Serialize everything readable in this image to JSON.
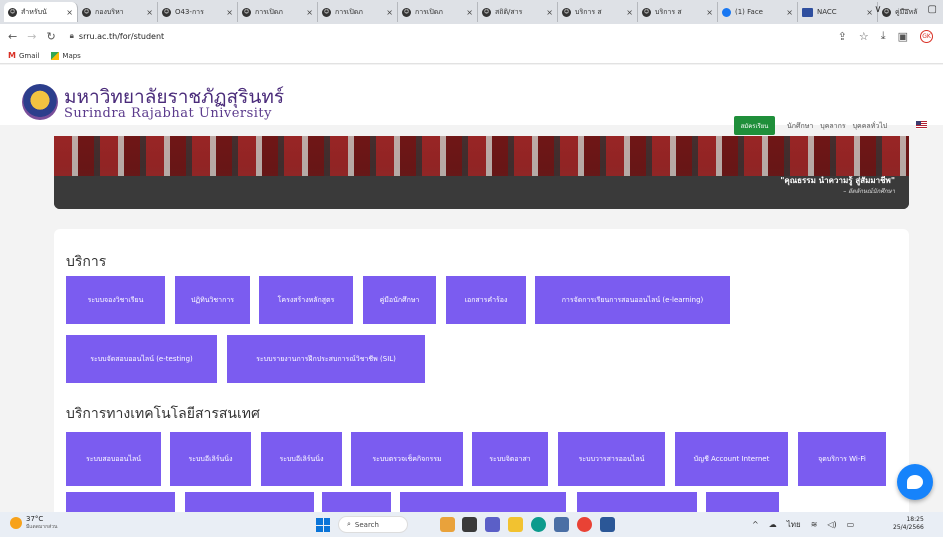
{
  "browser": {
    "tabs": [
      {
        "label": "สำหรับนั",
        "icon": "smile-favicon-icon",
        "active": true
      },
      {
        "label": "กองบริหา",
        "icon": "smile-favicon-icon"
      },
      {
        "label": "O43-การ",
        "icon": "smile-favicon-icon"
      },
      {
        "label": "การเปิดภ",
        "icon": "smile-favicon-icon"
      },
      {
        "label": "การเปิดภ",
        "icon": "smile-favicon-icon"
      },
      {
        "label": "การเปิดภ",
        "icon": "smile-favicon-icon"
      },
      {
        "label": "สถิติ/สาร",
        "icon": "smile-favicon-icon"
      },
      {
        "label": "บริการ ส",
        "icon": "smile-favicon-icon"
      },
      {
        "label": "บริการ ส",
        "icon": "smile-favicon-icon"
      },
      {
        "label": "(1) Face",
        "icon": "facebook-icon"
      },
      {
        "label": "NACC",
        "icon": "nacc-icon"
      },
      {
        "label": "คู่มือหลั",
        "icon": "smile-favicon-icon"
      }
    ],
    "tab_close": "×",
    "new_tab": "+",
    "window_controls": [
      "∨",
      "—",
      "▢"
    ],
    "url": "srru.ac.th/for/student",
    "bookmarks": [
      "Gmail",
      "Maps"
    ],
    "profile_initials": "GK"
  },
  "site": {
    "name_th": "มหาวิทยาลัยราชภัฏสุรินทร์",
    "name_en": "Surindra Rajabhat University",
    "apply_button": "สมัครเรียน",
    "nav": [
      "นักศึกษา",
      "บุคลากร",
      "บุคคลทั่วไป"
    ],
    "banner_quote": "\"คุณธรรม นำความรู้ สู่สัมมาชีพ\"",
    "banner_sub": "– อัตลักษณ์นักศึกษา"
  },
  "services": {
    "title": "บริการ",
    "row1": [
      "ระบบจองวิชาเรียน",
      "ปฏิทินวิชาการ",
      "โครงสร้างหลักสูตร",
      "คู่มือนักศึกษา",
      "เอกสารคำร้อง",
      "การจัดการเรียนการสอนออนไลน์ (e-learning)"
    ],
    "row2": [
      "ระบบจัดสอบออนไลน์ (e-testing)",
      "ระบบรายงานการฝึกประสบการณ์วิชาชีพ (SIL)"
    ]
  },
  "it_services": {
    "title": "บริการทางเทคโนโลยีสารสนเทศ",
    "row1": [
      "ระบบสอบออนไลน์",
      "ระบบอีเลิร์นนิ่ง",
      "ระบบอีเลิร์นนิ่ง",
      "ระบบตรวจเช็คกิจกรรม",
      "ระบบจิตอาสา",
      "ระบบวารสารออนไลน์",
      "บัญชี Account Internet",
      "จุดบริการ Wi-Fi"
    ]
  },
  "taskbar": {
    "temperature": "37°C",
    "weather": "มีแดดมากส่วน",
    "search": "Search",
    "lang": "ไทย",
    "time": "18:25",
    "date": "25/4/2566"
  }
}
